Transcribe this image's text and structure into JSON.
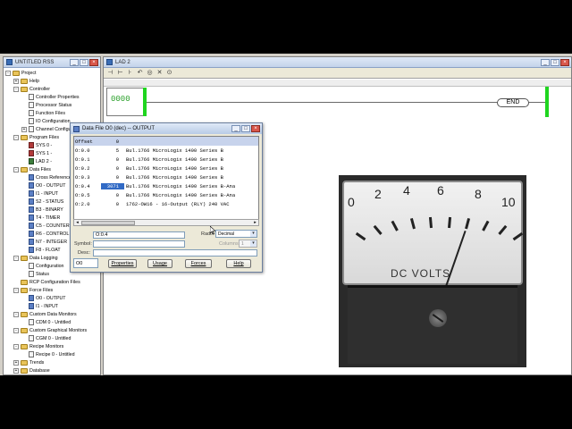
{
  "project_window": {
    "title": "UNTITLED RSS",
    "tree": [
      {
        "label": "Project",
        "level": 0,
        "icon": "folder-icon",
        "exp": "-"
      },
      {
        "label": "Help",
        "level": 1,
        "icon": "folder-icon",
        "exp": "+"
      },
      {
        "label": "Controller",
        "level": 1,
        "icon": "folder-icon",
        "exp": "-"
      },
      {
        "label": "Controller Properties",
        "level": 2,
        "icon": "doc-icon",
        "exp": ""
      },
      {
        "label": "Processor Status",
        "level": 2,
        "icon": "doc-icon",
        "exp": ""
      },
      {
        "label": "Function Files",
        "level": 2,
        "icon": "doc-icon",
        "exp": ""
      },
      {
        "label": "IO Configuration",
        "level": 2,
        "icon": "doc-icon",
        "exp": ""
      },
      {
        "label": "Channel Configuration",
        "level": 2,
        "icon": "doc-icon",
        "exp": "+"
      },
      {
        "label": "Program Files",
        "level": 1,
        "icon": "folder-icon",
        "exp": "-"
      },
      {
        "label": "SYS 0 -",
        "level": 2,
        "icon": "sys-icon",
        "exp": ""
      },
      {
        "label": "SYS 1 -",
        "level": 2,
        "icon": "sys-icon",
        "exp": ""
      },
      {
        "label": "LAD 2 -",
        "level": 2,
        "icon": "ladder-icon",
        "exp": ""
      },
      {
        "label": "Data Files",
        "level": 1,
        "icon": "folder-icon",
        "exp": "-"
      },
      {
        "label": "Cross Reference",
        "level": 2,
        "icon": "data-icon",
        "exp": ""
      },
      {
        "label": "O0 - OUTPUT",
        "level": 2,
        "icon": "data-icon",
        "exp": ""
      },
      {
        "label": "I1 - INPUT",
        "level": 2,
        "icon": "data-icon",
        "exp": ""
      },
      {
        "label": "S2 - STATUS",
        "level": 2,
        "icon": "data-icon",
        "exp": ""
      },
      {
        "label": "B3 - BINARY",
        "level": 2,
        "icon": "data-icon",
        "exp": ""
      },
      {
        "label": "T4 - TIMER",
        "level": 2,
        "icon": "data-icon",
        "exp": ""
      },
      {
        "label": "C5 - COUNTER",
        "level": 2,
        "icon": "data-icon",
        "exp": ""
      },
      {
        "label": "R6 - CONTROL",
        "level": 2,
        "icon": "data-icon",
        "exp": ""
      },
      {
        "label": "N7 - INTEGER",
        "level": 2,
        "icon": "data-icon",
        "exp": ""
      },
      {
        "label": "F8 - FLOAT",
        "level": 2,
        "icon": "data-icon",
        "exp": ""
      },
      {
        "label": "Data Logging",
        "level": 1,
        "icon": "folder-icon",
        "exp": "-"
      },
      {
        "label": "Configuration",
        "level": 2,
        "icon": "doc-icon",
        "exp": ""
      },
      {
        "label": "Status",
        "level": 2,
        "icon": "doc-icon",
        "exp": ""
      },
      {
        "label": "RCP Configuration Files",
        "level": 1,
        "icon": "folder-icon",
        "exp": ""
      },
      {
        "label": "Force Files",
        "level": 1,
        "icon": "folder-icon",
        "exp": "-"
      },
      {
        "label": "O0 - OUTPUT",
        "level": 2,
        "icon": "data-icon",
        "exp": ""
      },
      {
        "label": "I1 - INPUT",
        "level": 2,
        "icon": "data-icon",
        "exp": ""
      },
      {
        "label": "Custom Data Monitors",
        "level": 1,
        "icon": "folder-icon",
        "exp": "-"
      },
      {
        "label": "CDM 0 - Untitled",
        "level": 2,
        "icon": "doc-icon",
        "exp": ""
      },
      {
        "label": "Custom Graphical Monitors",
        "level": 1,
        "icon": "folder-icon",
        "exp": "-"
      },
      {
        "label": "CGM 0 - Untitled",
        "level": 2,
        "icon": "doc-icon",
        "exp": ""
      },
      {
        "label": "Recipe Monitors",
        "level": 1,
        "icon": "folder-icon",
        "exp": "-"
      },
      {
        "label": "Recipe 0 - Untitled",
        "level": 2,
        "icon": "doc-icon",
        "exp": ""
      },
      {
        "label": "Trends",
        "level": 1,
        "icon": "folder-icon",
        "exp": "+"
      },
      {
        "label": "Database",
        "level": 1,
        "icon": "folder-icon",
        "exp": "+"
      }
    ]
  },
  "ladder_window": {
    "title": "LAD 2",
    "rung_number": "0000",
    "end_label": "END",
    "rail_color": "#1fd51f"
  },
  "meter": {
    "scale": [
      "0",
      "2",
      "4",
      "6",
      "8",
      "10"
    ],
    "label": "DC VOLTS",
    "reading": 6.6
  },
  "dialog": {
    "title": "Data File O0 (dec) -- OUTPUT",
    "header": {
      "offset": "Offset",
      "value": "0",
      "desc": ""
    },
    "rows": [
      {
        "offset": "O:0.0",
        "value": "5",
        "desc": "Bul.1766     MicroLogix 1400 Series B"
      },
      {
        "offset": "O:0.1",
        "value": "0",
        "desc": "Bul.1766     MicroLogix 1400 Series B"
      },
      {
        "offset": "O:0.2",
        "value": "0",
        "desc": "Bul.1766     MicroLogix 1400 Series B"
      },
      {
        "offset": "O:0.3",
        "value": "0",
        "desc": "Bul.1766     MicroLogix 1400 Series B"
      },
      {
        "offset": "O:0.4",
        "value": "3071",
        "desc": "Bul.1766     MicroLogix 1400 Series B-Ana",
        "selected": true
      },
      {
        "offset": "O:0.5",
        "value": "0",
        "desc": "Bul.1766     MicroLogix 1400 Series B-Ana"
      },
      {
        "offset": "O:2.0",
        "value": "0",
        "desc": "1762-OW16 - 16-Output (RLY) 240 VAC"
      }
    ],
    "address": "O:0.4",
    "radix_label": "Radix:",
    "radix_value": "Decimal",
    "symbol_label": "Symbol:",
    "columns_label": "Columns:",
    "columns_value": "1",
    "desc_label": "Desc:",
    "spin_value": "O0",
    "buttons": {
      "properties": "Properties",
      "usage": "Usage",
      "forces": "Forces",
      "help": "Help"
    }
  }
}
